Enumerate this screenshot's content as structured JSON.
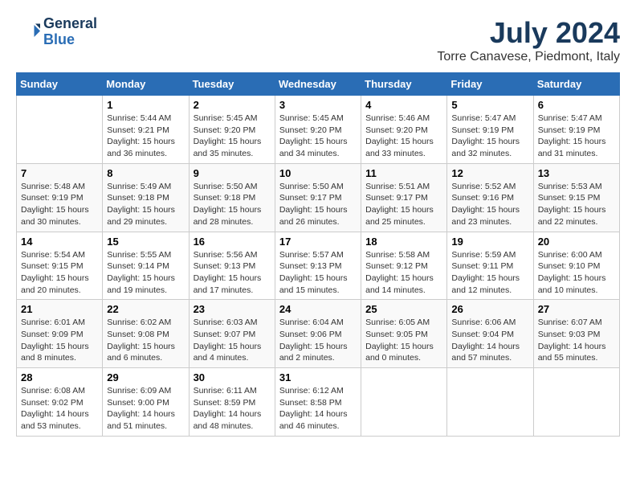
{
  "header": {
    "logo_line1": "General",
    "logo_line2": "Blue",
    "title": "July 2024",
    "subtitle": "Torre Canavese, Piedmont, Italy"
  },
  "days_of_week": [
    "Sunday",
    "Monday",
    "Tuesday",
    "Wednesday",
    "Thursday",
    "Friday",
    "Saturday"
  ],
  "weeks": [
    [
      {
        "num": "",
        "info": ""
      },
      {
        "num": "1",
        "info": "Sunrise: 5:44 AM\nSunset: 9:21 PM\nDaylight: 15 hours\nand 36 minutes."
      },
      {
        "num": "2",
        "info": "Sunrise: 5:45 AM\nSunset: 9:20 PM\nDaylight: 15 hours\nand 35 minutes."
      },
      {
        "num": "3",
        "info": "Sunrise: 5:45 AM\nSunset: 9:20 PM\nDaylight: 15 hours\nand 34 minutes."
      },
      {
        "num": "4",
        "info": "Sunrise: 5:46 AM\nSunset: 9:20 PM\nDaylight: 15 hours\nand 33 minutes."
      },
      {
        "num": "5",
        "info": "Sunrise: 5:47 AM\nSunset: 9:19 PM\nDaylight: 15 hours\nand 32 minutes."
      },
      {
        "num": "6",
        "info": "Sunrise: 5:47 AM\nSunset: 9:19 PM\nDaylight: 15 hours\nand 31 minutes."
      }
    ],
    [
      {
        "num": "7",
        "info": "Sunrise: 5:48 AM\nSunset: 9:19 PM\nDaylight: 15 hours\nand 30 minutes."
      },
      {
        "num": "8",
        "info": "Sunrise: 5:49 AM\nSunset: 9:18 PM\nDaylight: 15 hours\nand 29 minutes."
      },
      {
        "num": "9",
        "info": "Sunrise: 5:50 AM\nSunset: 9:18 PM\nDaylight: 15 hours\nand 28 minutes."
      },
      {
        "num": "10",
        "info": "Sunrise: 5:50 AM\nSunset: 9:17 PM\nDaylight: 15 hours\nand 26 minutes."
      },
      {
        "num": "11",
        "info": "Sunrise: 5:51 AM\nSunset: 9:17 PM\nDaylight: 15 hours\nand 25 minutes."
      },
      {
        "num": "12",
        "info": "Sunrise: 5:52 AM\nSunset: 9:16 PM\nDaylight: 15 hours\nand 23 minutes."
      },
      {
        "num": "13",
        "info": "Sunrise: 5:53 AM\nSunset: 9:15 PM\nDaylight: 15 hours\nand 22 minutes."
      }
    ],
    [
      {
        "num": "14",
        "info": "Sunrise: 5:54 AM\nSunset: 9:15 PM\nDaylight: 15 hours\nand 20 minutes."
      },
      {
        "num": "15",
        "info": "Sunrise: 5:55 AM\nSunset: 9:14 PM\nDaylight: 15 hours\nand 19 minutes."
      },
      {
        "num": "16",
        "info": "Sunrise: 5:56 AM\nSunset: 9:13 PM\nDaylight: 15 hours\nand 17 minutes."
      },
      {
        "num": "17",
        "info": "Sunrise: 5:57 AM\nSunset: 9:13 PM\nDaylight: 15 hours\nand 15 minutes."
      },
      {
        "num": "18",
        "info": "Sunrise: 5:58 AM\nSunset: 9:12 PM\nDaylight: 15 hours\nand 14 minutes."
      },
      {
        "num": "19",
        "info": "Sunrise: 5:59 AM\nSunset: 9:11 PM\nDaylight: 15 hours\nand 12 minutes."
      },
      {
        "num": "20",
        "info": "Sunrise: 6:00 AM\nSunset: 9:10 PM\nDaylight: 15 hours\nand 10 minutes."
      }
    ],
    [
      {
        "num": "21",
        "info": "Sunrise: 6:01 AM\nSunset: 9:09 PM\nDaylight: 15 hours\nand 8 minutes."
      },
      {
        "num": "22",
        "info": "Sunrise: 6:02 AM\nSunset: 9:08 PM\nDaylight: 15 hours\nand 6 minutes."
      },
      {
        "num": "23",
        "info": "Sunrise: 6:03 AM\nSunset: 9:07 PM\nDaylight: 15 hours\nand 4 minutes."
      },
      {
        "num": "24",
        "info": "Sunrise: 6:04 AM\nSunset: 9:06 PM\nDaylight: 15 hours\nand 2 minutes."
      },
      {
        "num": "25",
        "info": "Sunrise: 6:05 AM\nSunset: 9:05 PM\nDaylight: 15 hours\nand 0 minutes."
      },
      {
        "num": "26",
        "info": "Sunrise: 6:06 AM\nSunset: 9:04 PM\nDaylight: 14 hours\nand 57 minutes."
      },
      {
        "num": "27",
        "info": "Sunrise: 6:07 AM\nSunset: 9:03 PM\nDaylight: 14 hours\nand 55 minutes."
      }
    ],
    [
      {
        "num": "28",
        "info": "Sunrise: 6:08 AM\nSunset: 9:02 PM\nDaylight: 14 hours\nand 53 minutes."
      },
      {
        "num": "29",
        "info": "Sunrise: 6:09 AM\nSunset: 9:00 PM\nDaylight: 14 hours\nand 51 minutes."
      },
      {
        "num": "30",
        "info": "Sunrise: 6:11 AM\nSunset: 8:59 PM\nDaylight: 14 hours\nand 48 minutes."
      },
      {
        "num": "31",
        "info": "Sunrise: 6:12 AM\nSunset: 8:58 PM\nDaylight: 14 hours\nand 46 minutes."
      },
      {
        "num": "",
        "info": ""
      },
      {
        "num": "",
        "info": ""
      },
      {
        "num": "",
        "info": ""
      }
    ]
  ]
}
